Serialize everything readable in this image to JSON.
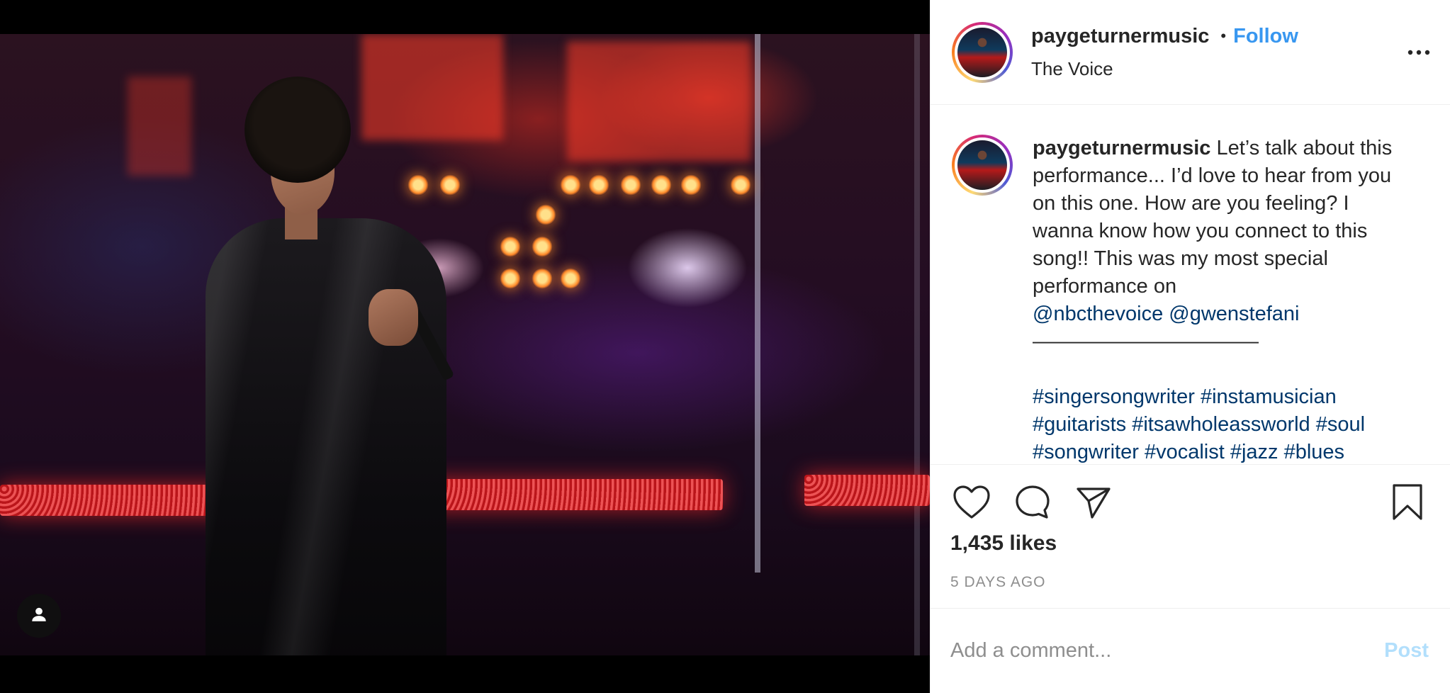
{
  "post": {
    "username": "paygeturnermusic",
    "follow_label": "Follow",
    "separator": "•",
    "location": "The Voice"
  },
  "caption": {
    "username": "paygeturnermusic",
    "text": "Let’s talk about this performance... I’d love to hear from you on this one. How are you feeling? I wanna know how you connect to this song!! This was my most special performance on",
    "mention_1": "@nbcthevoice",
    "mention_2": "@gwenstefani",
    "divider": "———————————",
    "hashtags_line_1": "#singersongwriter #instamusician",
    "hashtags_line_2": "#guitarists #itsawholeassworld #soul",
    "hashtags_line_3": "#songwriter #vocalist #jazz #blues"
  },
  "engagement": {
    "likes": "1,435 likes",
    "timestamp": "5 DAYS AGO"
  },
  "comment": {
    "placeholder": "Add a comment...",
    "post_label": "Post"
  },
  "icons": {
    "like": "heart-icon",
    "comment": "comment-bubble-icon",
    "share": "paper-plane-icon",
    "save": "bookmark-icon",
    "more": "ellipsis-icon",
    "user_tag": "person-icon"
  },
  "colors": {
    "link": "#3897f0",
    "hashtag": "#00376b",
    "post_disabled": "#b2dffc",
    "muted": "#8e8e8e"
  }
}
